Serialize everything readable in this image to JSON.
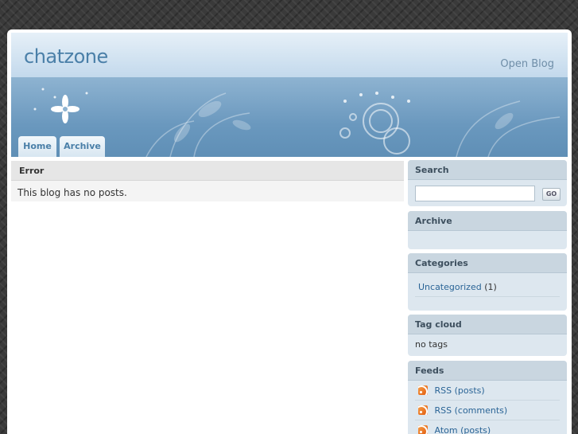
{
  "header": {
    "title": "chatzone",
    "description": "Open Blog"
  },
  "nav": {
    "tabs": [
      {
        "label": "Home"
      },
      {
        "label": "Archive"
      }
    ]
  },
  "main": {
    "title": "Error",
    "message": "This blog has no posts."
  },
  "sidebar": {
    "search": {
      "title": "Search",
      "value": "",
      "button_label": "GO"
    },
    "archive": {
      "title": "Archive"
    },
    "categories": {
      "title": "Categories",
      "items": [
        {
          "label": "Uncategorized",
          "count": "(1)"
        }
      ]
    },
    "tagcloud": {
      "title": "Tag cloud",
      "text": "no tags"
    },
    "feeds": {
      "title": "Feeds",
      "items": [
        {
          "label": "RSS (posts)"
        },
        {
          "label": "RSS (comments)"
        },
        {
          "label": "Atom (posts)"
        }
      ]
    }
  },
  "colors": {
    "accent": "#4a7fa8",
    "link": "#2a6496",
    "banner": "#6a98be"
  }
}
